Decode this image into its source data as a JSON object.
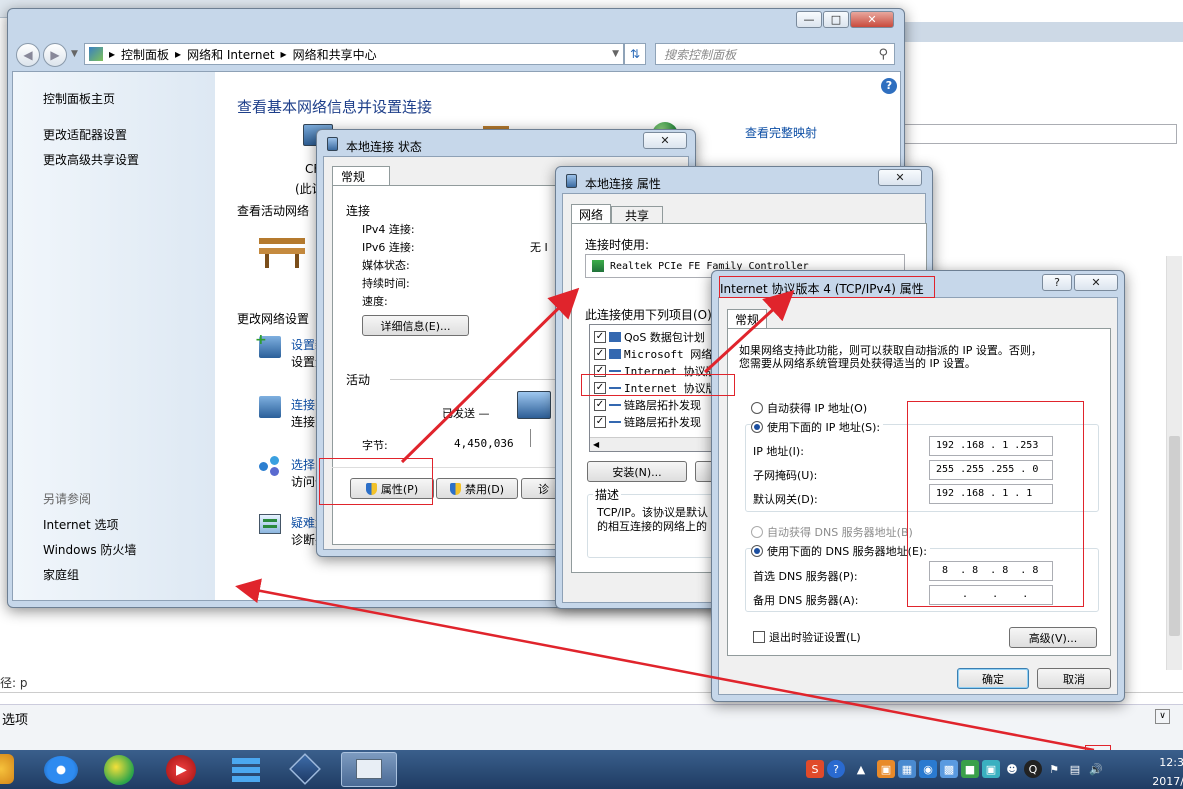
{
  "bg": {
    "left_frag": "径: p",
    "bottom_bar": "选项"
  },
  "network_center": {
    "breadcrumb": [
      "控制面板",
      "网络和 Internet",
      "网络和共享中心"
    ],
    "search_placeholder": "搜索控制面板",
    "sidebar": {
      "home": "控制面板主页",
      "items": [
        "更改适配器设置",
        "更改高级共享设置"
      ],
      "see_also_title": "另请参阅",
      "see_also": [
        "Internet 选项",
        "Windows 防火墙",
        "家庭组"
      ]
    },
    "main": {
      "title": "查看基本网络信息并设置连接",
      "full_map": "查看完整映射",
      "computer_name": "CF",
      "computer_sub": "(此计",
      "active_networks": "查看活动网络",
      "change_settings": "更改网络设置",
      "tasks": [
        {
          "title": "设置新",
          "desc": "设置无"
        },
        {
          "title": "连接到",
          "desc": "连接到"
        },
        {
          "title": "选择家",
          "desc": "访问位"
        },
        {
          "title": "疑难解",
          "desc": "诊断并"
        }
      ]
    }
  },
  "status_dialog": {
    "title": "本地连接 状态",
    "tab": "常规",
    "connection_section": "连接",
    "rows": [
      {
        "label": "IPv4 连接:",
        "value": ""
      },
      {
        "label": "IPv6 连接:",
        "value": "无 I"
      },
      {
        "label": "媒体状态:",
        "value": ""
      },
      {
        "label": "持续时间:",
        "value": ""
      },
      {
        "label": "速度:",
        "value": ""
      }
    ],
    "details_btn": "详细信息(E)...",
    "activity_section": "活动",
    "sent_label": "已发送 —",
    "bytes_label": "字节:",
    "bytes_value": "4,450,036",
    "properties_btn": "属性(P)",
    "disable_btn": "禁用(D)",
    "diagnose_btn": "诊"
  },
  "props_dialog": {
    "title": "本地连接 属性",
    "tabs": [
      "网络",
      "共享"
    ],
    "connect_using": "连接时使用:",
    "adapter": "Realtek PCIe FE Family Controller",
    "items_label": "此连接使用下列项目(O):",
    "items": [
      "QoS 数据包计划",
      "Microsoft 网络",
      "Internet 协议版",
      "Internet 协议版",
      "链路层拓扑发现",
      "链路层拓扑发现"
    ],
    "install_btn": "安装(N)...",
    "desc_label": "描述",
    "desc_text": [
      "TCP/IP。该协议是默认",
      "的相互连接的网络上的"
    ]
  },
  "ipv4_dialog": {
    "title": "Internet 协议版本 4 (TCP/IPv4) 属性",
    "tab": "常规",
    "intro": [
      "如果网络支持此功能，则可以获取自动指派的 IP 设置。否则，",
      "您需要从网络系统管理员处获得适当的 IP 设置。"
    ],
    "auto_ip": "自动获得 IP 地址(O)",
    "use_ip": "使用下面的 IP 地址(S):",
    "ip_label": "IP 地址(I):",
    "ip_value": "192 .168 . 1  .253",
    "mask_label": "子网掩码(U):",
    "mask_value": "255 .255 .255 . 0",
    "gateway_label": "默认网关(D):",
    "gateway_value": "192 .168 . 1  . 1",
    "auto_dns": "自动获得 DNS 服务器地址(B)",
    "use_dns": "使用下面的 DNS 服务器地址(E):",
    "dns1_label": "首选 DNS 服务器(P):",
    "dns1_value": " 8  . 8  . 8  . 8",
    "dns2_label": "备用 DNS 服务器(A):",
    "dns2_value": ".    .    .",
    "validate": "退出时验证设置(L)",
    "advanced_btn": "高级(V)...",
    "ok_btn": "确定",
    "cancel_btn": "取消"
  },
  "taskbar": {
    "time": "12:3",
    "date": "2017/"
  }
}
